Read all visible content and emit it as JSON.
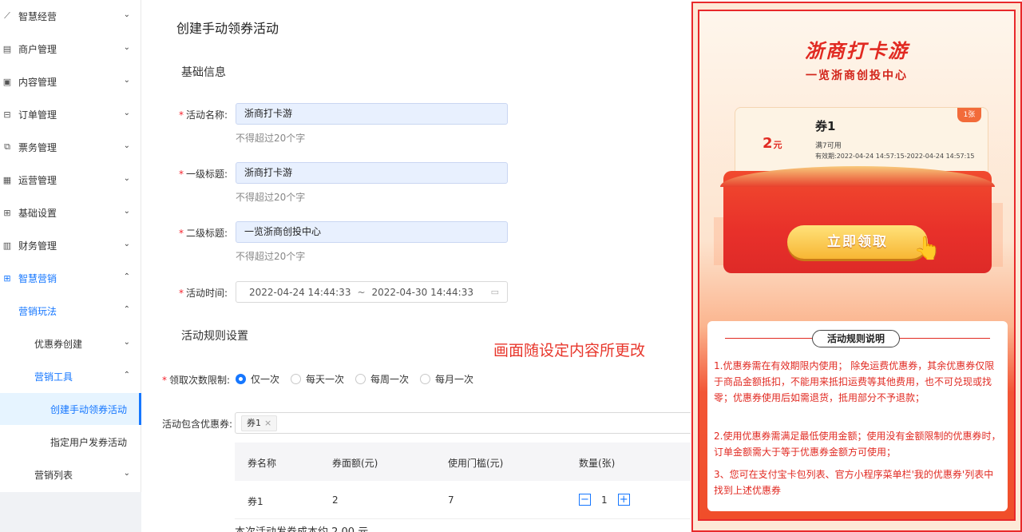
{
  "sidebar": {
    "items": [
      {
        "label": "智慧经营",
        "icon": "line-chart-icon",
        "chev": "⌄"
      },
      {
        "label": "商户管理",
        "icon": "shop-icon",
        "chev": "⌄"
      },
      {
        "label": "内容管理",
        "icon": "document-icon",
        "chev": "⌄"
      },
      {
        "label": "订单管理",
        "icon": "order-icon",
        "chev": "⌄"
      },
      {
        "label": "票务管理",
        "icon": "ticket-icon",
        "chev": "⌄"
      },
      {
        "label": "运营管理",
        "icon": "operation-icon",
        "chev": "⌄"
      },
      {
        "label": "基础设置",
        "icon": "settings-icon",
        "chev": "⌄"
      },
      {
        "label": "财务管理",
        "icon": "bar-chart-icon",
        "chev": "⌄"
      },
      {
        "label": "智慧营销",
        "icon": "grid-icon",
        "chev": "⌃"
      },
      {
        "label": "营销玩法",
        "chev": "⌃"
      },
      {
        "label": "优惠券创建",
        "chev": "⌄"
      },
      {
        "label": "营销工具",
        "chev": "⌃"
      },
      {
        "label": "创建手动领券活动"
      },
      {
        "label": "指定用户发券活动"
      },
      {
        "label": "营销列表",
        "chev": "⌄"
      }
    ]
  },
  "form": {
    "page_title": "创建手动领券活动",
    "section_basic": "基础信息",
    "required_mark": "*",
    "name_label": "活动名称:",
    "name_value": "浙商打卡游",
    "name_hint": "不得超过20个字",
    "title1_label": "一级标题:",
    "title1_value": "浙商打卡游",
    "title1_hint": "不得超过20个字",
    "title2_label": "二级标题:",
    "title2_value": "一览浙商创投中心",
    "title2_hint": "不得超过20个字",
    "time_label": "活动时间:",
    "time_start": "2022-04-24 14:44:33",
    "time_sep": "~",
    "time_end": "2022-04-30 14:44:33",
    "section_rules": "活动规则设置",
    "note": "画面随设定内容所更改",
    "limit_label": "领取次数限制:",
    "limit_options": [
      "仅一次",
      "每天一次",
      "每周一次",
      "每月一次"
    ],
    "coupons_label": "活动包含优惠券:",
    "coupon_tag": "券1",
    "coupon_tag_close": "×",
    "table_headers": [
      "券名称",
      "券面额(元)",
      "使用门槛(元)",
      "数量(张)"
    ],
    "table_row": {
      "name": "券1",
      "amount": "2",
      "threshold": "7",
      "qty": "1"
    },
    "stepper_minus": "−",
    "stepper_plus": "+",
    "cost_text": "本次活动发券成本约 2.00 元"
  },
  "preview": {
    "title": "浙商打卡游",
    "subtitle": "一览浙商创投中心",
    "ticket_badge": "1张",
    "ticket_amount": "2",
    "ticket_unit": "元",
    "ticket_name": "券1",
    "ticket_threshold": "满7可用",
    "ticket_valid": "有效期:2022-04-24 14:57:15-2022-04-24 14:57:15",
    "claim_button": "立即领取",
    "rules_title": "活动规则说明",
    "rule1": "1.优惠券需在有效期限内使用； 除免运费优惠券，其余优惠券仅限于商品金额抵扣，不能用来抵扣运费等其他费用，也不可兑现或找零；优惠券使用后如需退货，抵用部分不予退款；",
    "rule2": "2.使用优惠券需满足最低使用金额；使用没有金额限制的优惠券时，订单金额需大于等于优惠券金额方可使用；",
    "rule3": "3、您可在支付宝卡包列表、官方小程序菜单栏'我的优惠券'列表中找到上述优惠券"
  },
  "colors": {
    "primary": "#1677ff",
    "required": "#f5222d",
    "preview_red": "#e12a22",
    "note_red": "#e8372c"
  }
}
